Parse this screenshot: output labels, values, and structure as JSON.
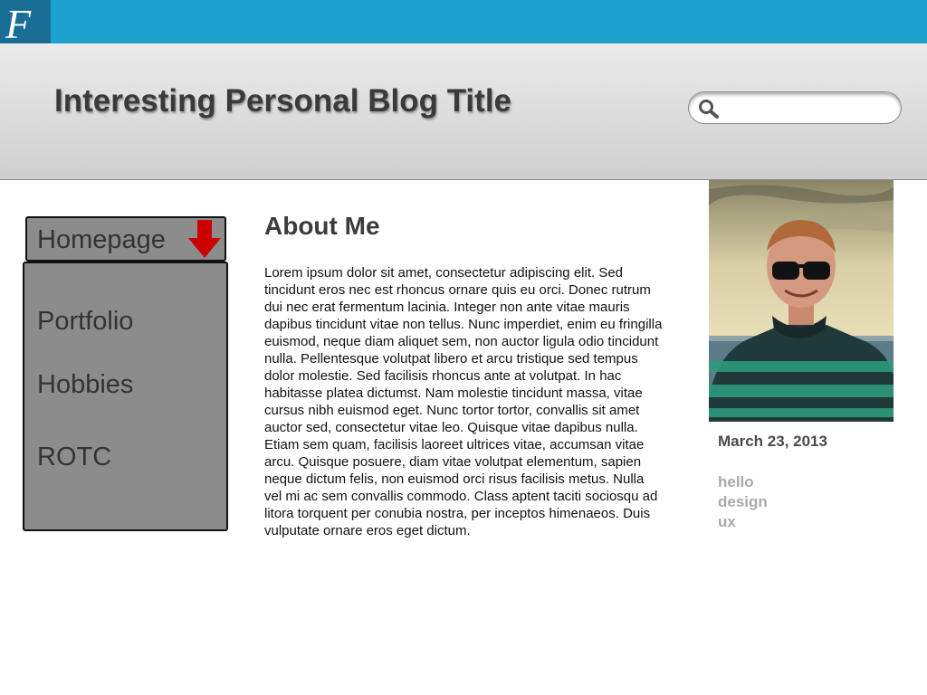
{
  "logo": {
    "letter": "F"
  },
  "header": {
    "site_title": "Interesting Personal Blog Title",
    "search": {
      "placeholder": "",
      "value": "",
      "icon": "search-icon"
    }
  },
  "nav": {
    "current": "Homepage",
    "current_icon": "arrow-down-icon",
    "items": [
      "Portfolio",
      "Hobbies",
      "ROTC"
    ]
  },
  "article": {
    "heading": "About Me",
    "body": "Lorem ipsum dolor sit amet, consectetur adipiscing elit. Sed tincidunt eros nec est rhoncus ornare quis eu orci. Donec rutrum dui nec erat fermentum lacinia. Integer non ante vitae mauris dapibus tincidunt vitae non tellus. Nunc imperdiet, enim eu fringilla euismod, neque diam aliquet sem, non auctor ligula odio tincidunt nulla. Pellentesque volutpat libero et arcu tristique sed tempus dolor molestie. Sed facilisis rhoncus ante at volutpat. In hac habitasse platea dictumst. Nam molestie tincidunt massa, vitae cursus nibh euismod eget. Nunc tortor tortor, convallis sit amet auctor sed, consectetur vitae leo. Quisque vitae dapibus nulla. Etiam sem quam, facilisis laoreet ultrices vitae, accumsan vitae arcu. Quisque posuere, diam vitae volutpat elementum, sapien neque dictum felis, non euismod orci risus facilisis metus. Nulla vel mi ac sem convallis commodo. Class aptent taciti sociosqu ad litora torquent per conubia nostra, per inceptos himenaeos. Duis vulputate ornare eros eget dictum."
  },
  "sidebar": {
    "date": "March 23, 2013",
    "tags": [
      "hello",
      "design",
      "ux"
    ]
  },
  "colors": {
    "topbar": "#1da1cf",
    "logo_bg": "#1a6e96",
    "nav_bg": "#8c8c8c",
    "arrow": "#cc0000",
    "tag": "#a9a9a9"
  }
}
